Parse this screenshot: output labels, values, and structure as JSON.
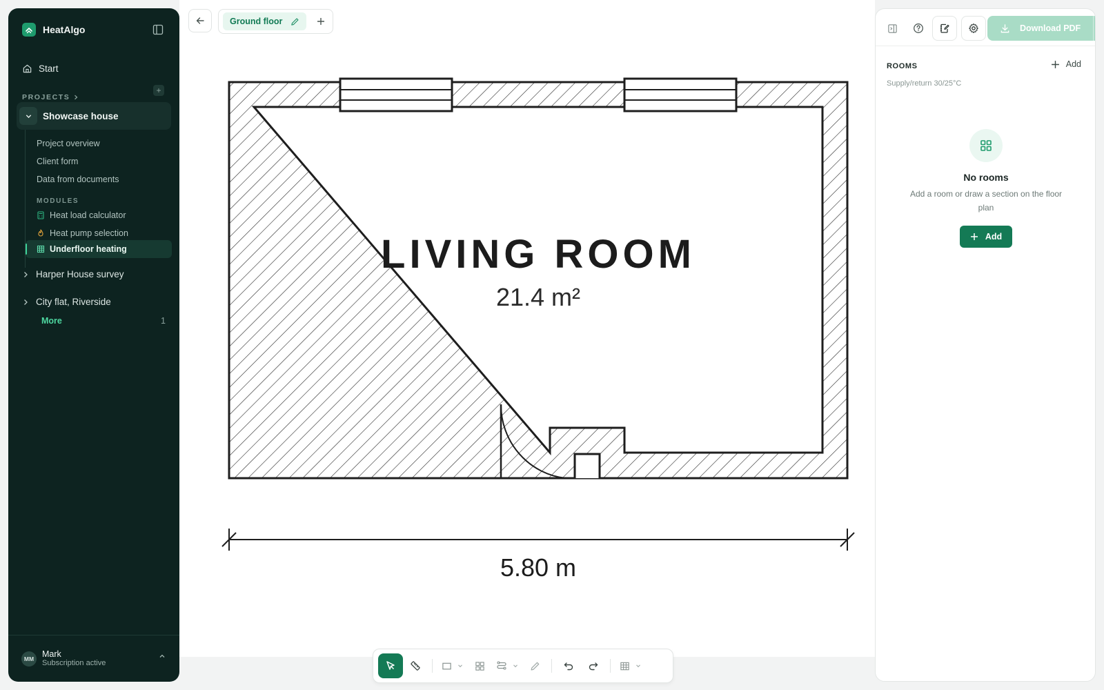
{
  "app": {
    "name": "HeatAlgo"
  },
  "sidebar": {
    "start_label": "Start",
    "projects_label": "PROJECTS",
    "active_project": {
      "name": "Showcase house",
      "items": [
        "Project overview",
        "Client form",
        "Data from documents"
      ],
      "modules_label": "MODULES",
      "modules": [
        {
          "label": "Heat load calculator",
          "icon": "calculator-icon"
        },
        {
          "label": "Heat pump selection",
          "icon": "flame-icon"
        },
        {
          "label": "Underfloor heating",
          "icon": "grid-icon",
          "active": true
        }
      ]
    },
    "projects": [
      "Harper House survey",
      "City flat, Riverside"
    ],
    "more_label": "More",
    "more_count": "1",
    "user": {
      "initials": "MM",
      "name": "Mark",
      "status": "Subscription active"
    }
  },
  "floor": {
    "current_tab": "Ground floor"
  },
  "plan": {
    "room_name": "LIVING ROOM",
    "room_area": "21.4 m²",
    "dimension": "5.80 m"
  },
  "panel": {
    "download_label": "Download PDF",
    "rooms_title": "ROOMS",
    "add_label": "Add",
    "supply_return": "Supply/return 30/25°C",
    "empty_title": "No rooms",
    "empty_desc": "Add a room or draw a section on the floor plan",
    "empty_add_label": "Add"
  },
  "colors": {
    "sidebar_bg": "#0d2320",
    "accent": "#147a55",
    "accent_light": "#e7f6ef",
    "highlight_green": "#4ed8a1",
    "download_disabled": "#a9dcc6"
  }
}
